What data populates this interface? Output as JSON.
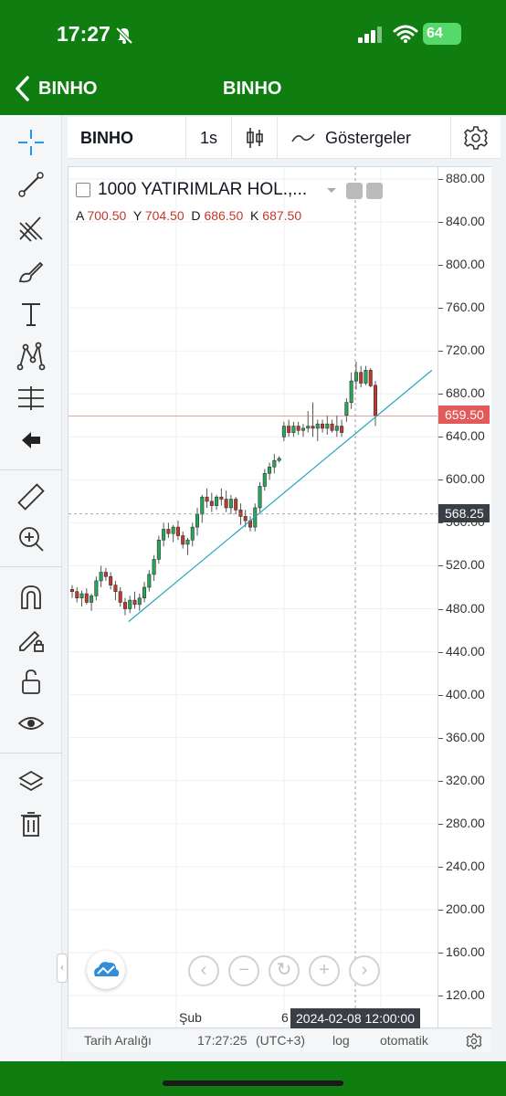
{
  "status": {
    "time": "17:27",
    "battery": "64"
  },
  "nav": {
    "back_label": "BINHO",
    "title": "BINHO"
  },
  "toolbar": {
    "symbol": "BINHO",
    "interval": "1s",
    "indicators": "Göstergeler"
  },
  "legend": {
    "title": "1000 YATIRIMLAR HOL.,...",
    "open_label": "A",
    "open": "700.50",
    "high_label": "Y",
    "high": "704.50",
    "low_label": "D",
    "low": "686.50",
    "close_label": "K",
    "close": "687.50"
  },
  "price_axis": {
    "ticks": [
      "880.00",
      "840.00",
      "800.00",
      "760.00",
      "720.00",
      "680.00",
      "640.00",
      "600.00",
      "560.00",
      "520.00",
      "480.00",
      "440.00",
      "400.00",
      "360.00",
      "320.00",
      "280.00",
      "240.00",
      "200.00",
      "160.00",
      "120.00"
    ],
    "last_price": "659.50",
    "crosshair_price": "568.25"
  },
  "time_axis": {
    "label_1": "Şub",
    "label_2": "6",
    "crosshair_time": "2024-02-08 12:00:00"
  },
  "bottom": {
    "range": "Tarih Aralığı",
    "clock": "17:27:25",
    "tz": "(UTC+3)",
    "log": "log",
    "auto": "otomatik"
  },
  "colors": {
    "up": "#26a65b",
    "down": "#c0392b",
    "header": "#0f7d10",
    "trendline": "#2aa7b8"
  },
  "chart_data": {
    "type": "candlestick",
    "ylim": [
      110,
      890
    ],
    "candles": [
      [
        498,
        502,
        490,
        496
      ],
      [
        496,
        500,
        486,
        490
      ],
      [
        490,
        497,
        482,
        494
      ],
      [
        494,
        499,
        484,
        486
      ],
      [
        486,
        494,
        478,
        492
      ],
      [
        492,
        510,
        488,
        506
      ],
      [
        506,
        520,
        500,
        514
      ],
      [
        514,
        518,
        506,
        510
      ],
      [
        510,
        514,
        498,
        502
      ],
      [
        502,
        506,
        488,
        496
      ],
      [
        496,
        500,
        482,
        486
      ],
      [
        486,
        490,
        474,
        480
      ],
      [
        480,
        492,
        476,
        488
      ],
      [
        488,
        496,
        480,
        484
      ],
      [
        484,
        494,
        478,
        490
      ],
      [
        490,
        505,
        486,
        500
      ],
      [
        500,
        516,
        496,
        512
      ],
      [
        512,
        530,
        506,
        526
      ],
      [
        526,
        548,
        522,
        544
      ],
      [
        544,
        560,
        538,
        554
      ],
      [
        554,
        560,
        546,
        550
      ],
      [
        550,
        558,
        542,
        556
      ],
      [
        556,
        562,
        544,
        548
      ],
      [
        548,
        552,
        536,
        540
      ],
      [
        540,
        546,
        530,
        544
      ],
      [
        544,
        560,
        538,
        556
      ],
      [
        556,
        574,
        548,
        568
      ],
      [
        568,
        586,
        560,
        584
      ],
      [
        584,
        592,
        574,
        580
      ],
      [
        580,
        588,
        570,
        576
      ],
      [
        576,
        586,
        572,
        584
      ],
      [
        584,
        592,
        576,
        582
      ],
      [
        582,
        590,
        570,
        574
      ],
      [
        574,
        586,
        568,
        582
      ],
      [
        582,
        584,
        568,
        572
      ],
      [
        572,
        578,
        558,
        566
      ],
      [
        566,
        572,
        556,
        562
      ],
      [
        562,
        566,
        552,
        556
      ],
      [
        556,
        578,
        552,
        574
      ],
      [
        574,
        598,
        570,
        594
      ],
      [
        594,
        610,
        590,
        606
      ],
      [
        606,
        616,
        600,
        612
      ],
      [
        612,
        624,
        606,
        618
      ],
      [
        618,
        622,
        616,
        620
      ],
      [
        640,
        654,
        636,
        650
      ],
      [
        650,
        656,
        640,
        644
      ],
      [
        644,
        654,
        640,
        650
      ],
      [
        650,
        654,
        642,
        646
      ],
      [
        646,
        652,
        640,
        648
      ],
      [
        648,
        664,
        644,
        650
      ],
      [
        650,
        672,
        640,
        648
      ],
      [
        648,
        656,
        636,
        652
      ],
      [
        652,
        656,
        644,
        648
      ],
      [
        648,
        660,
        642,
        652
      ],
      [
        652,
        656,
        644,
        646
      ],
      [
        646,
        660,
        640,
        650
      ],
      [
        650,
        656,
        640,
        644
      ],
      [
        660,
        676,
        654,
        672
      ],
      [
        672,
        700,
        666,
        692
      ],
      [
        692,
        710,
        684,
        700
      ],
      [
        700,
        706,
        686,
        690
      ],
      [
        690,
        706,
        688,
        702
      ],
      [
        702,
        704,
        686,
        687.5
      ],
      [
        688,
        692,
        650,
        659.5
      ]
    ],
    "trendline": [
      [
        0.162,
        468
      ],
      [
        0.98,
        702
      ]
    ]
  }
}
